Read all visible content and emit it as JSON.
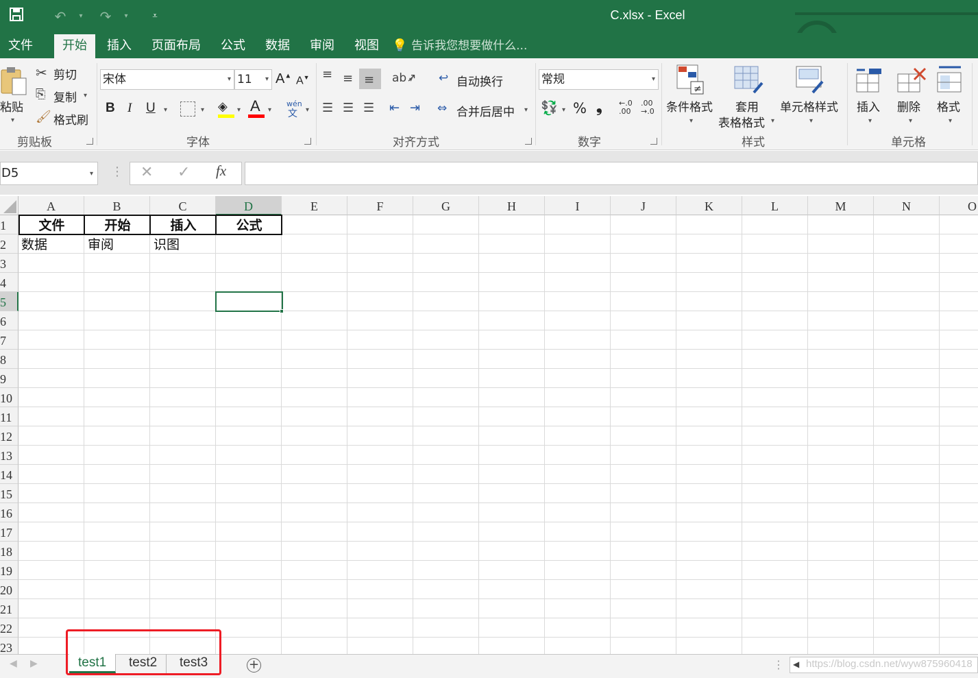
{
  "window": {
    "title": "C.xlsx - Excel"
  },
  "menu_tabs": [
    "文件",
    "开始",
    "插入",
    "页面布局",
    "公式",
    "数据",
    "审阅",
    "视图"
  ],
  "active_menu_tab": "开始",
  "tell_me": "告诉我您想要做什么...",
  "clipboard": {
    "paste": "粘贴",
    "cut": "剪切",
    "copy": "复制",
    "format_painter": "格式刷",
    "group": "剪贴板"
  },
  "font": {
    "name": "宋体",
    "size": "11",
    "bold": "B",
    "italic": "I",
    "underline": "U",
    "font_color_glyph": "A",
    "phonetic_top": "wén",
    "phonetic_bottom": "文",
    "grow": "A",
    "shrink": "A",
    "group": "字体"
  },
  "alignment": {
    "wrap_text": "自动换行",
    "merge_center": "合并后居中",
    "group": "对齐方式"
  },
  "number": {
    "format": "常规",
    "percent": "%",
    "comma": "❟",
    "inc_decimal_a": "←.0",
    "inc_decimal_b": ".00",
    "dec_decimal_a": ".00",
    "dec_decimal_b": "→.0",
    "group": "数字"
  },
  "styles": {
    "conditional": "条件格式",
    "table_format_1": "套用",
    "table_format_2": "表格格式",
    "cell_styles": "单元格样式",
    "group": "样式"
  },
  "cells": {
    "insert": "插入",
    "delete": "删除",
    "format": "格式",
    "group": "单元格"
  },
  "formula_bar": {
    "name_box": "D5",
    "formula": "",
    "fx": "fx",
    "cancel": "✕",
    "enter": "✓"
  },
  "columns": [
    "A",
    "B",
    "C",
    "D",
    "E",
    "F",
    "G",
    "H",
    "I",
    "J",
    "K",
    "L",
    "M",
    "N",
    "O"
  ],
  "rows": [
    "1",
    "2",
    "3",
    "4",
    "5",
    "6",
    "7",
    "8",
    "9",
    "10",
    "11",
    "12",
    "13",
    "14",
    "15",
    "16",
    "17",
    "18",
    "19",
    "20",
    "21",
    "22",
    "23"
  ],
  "selected_cell": "D5",
  "cells_data": {
    "A1": "文件",
    "B1": "开始",
    "C1": "插入",
    "D1": "公式",
    "A2": "数据",
    "B2": "审阅",
    "C2": "识图"
  },
  "sheets": [
    "test1",
    "test2",
    "test3"
  ],
  "active_sheet": "test1",
  "add_sheet": "⊕",
  "watermark": "https://blog.csdn.net/wyw875960418",
  "colors": {
    "excel_green": "#217346",
    "highlight_red": "#ee1c25"
  }
}
